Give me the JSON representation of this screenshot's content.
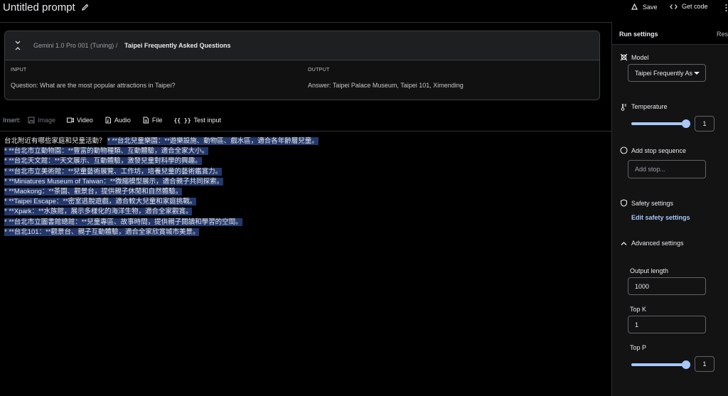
{
  "header": {
    "title": "Untitled prompt",
    "save_label": "Save",
    "get_code_label": "Get code"
  },
  "example": {
    "model_crumb": "Gemini 1.0 Pro 001 (Tuning) /",
    "dataset_crumb": "Taipei Frequently Asked Questions",
    "input_label": "INPUT",
    "output_label": "OUTPUT",
    "input_text": "Question: What are the most popular attractions in Taipei?",
    "output_text": "Answer: Taipei Palace Museum, Taipei 101, Ximending"
  },
  "insert": {
    "label": "Insert:",
    "items": [
      "Image",
      "Video",
      "Audio",
      "File",
      "Test input"
    ]
  },
  "prompt": {
    "question": "台北附近有哪些家庭和兒童活動？",
    "lines": [
      "* **台北兒童樂園：**遊樂設施、動物區、戲水區，適合各年齡層兒童。",
      "* **台北市立動物園：**豐富的動物種類、互動體驗，適合全家大小。",
      "* **台北天文館：**天文展示、互動體驗，激發兒童對科學的興趣。",
      "* **台北市立美術館：**兒童藝術展覽、工作坊，培養兒童的藝術鑑賞力。",
      "* **Miniatures Museum of Taiwan：**微縮模型展示，適合親子共同探索。",
      "* **Maokong：**茶園、觀景台，提供親子休閒和自然體驗。",
      "* **Taipei Escape：**密室逃脫遊戲，適合較大兒童和家庭挑戰。",
      "* **Xpark：**水族館，展示多樣化的海洋生物，適合全家觀賞。",
      "* **台北市立圖書館總館：**兒童專區、故事時間，提供親子閱讀和學習的空間。",
      "* **台北101：**觀景台、親子互動體驗，適合全家欣賞城市美景。"
    ]
  },
  "settings": {
    "title": "Run settings",
    "tab2": "Res",
    "model_label": "Model",
    "model_value": "Taipei Frequently As",
    "temperature_label": "Temperature",
    "temperature_value": "1",
    "temperature_fraction": 1.0,
    "stop_label": "Add stop sequence",
    "stop_placeholder": "Add stop...",
    "safety_label": "Safety settings",
    "safety_link": "Edit safety settings",
    "advanced_label": "Advanced settings",
    "output_length_label": "Output length",
    "output_length_value": "1000",
    "top_k_label": "Top K",
    "top_k_value": "1",
    "top_p_label": "Top P",
    "top_p_value": "1",
    "top_p_fraction": 1.0
  },
  "colors": {
    "selection": "#24386b",
    "accent": "#a8c7fa",
    "background": "#000000"
  }
}
